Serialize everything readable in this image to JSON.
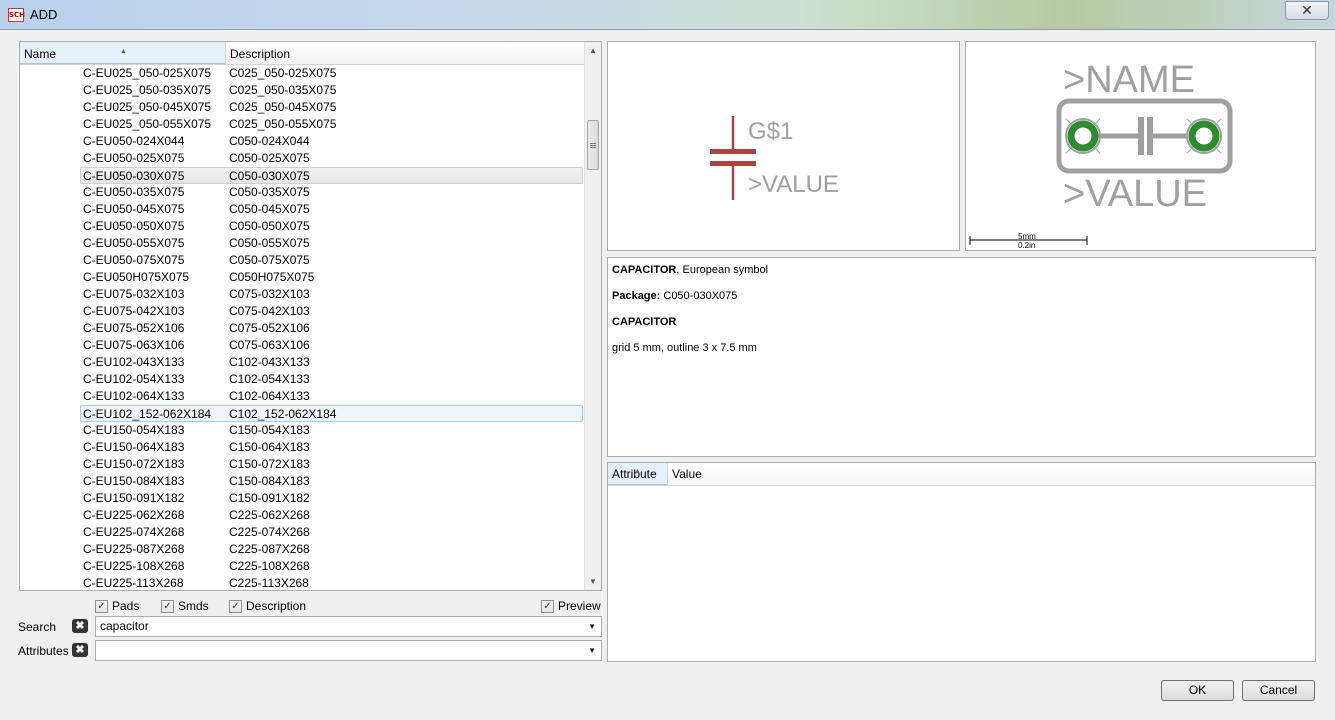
{
  "window": {
    "title": "ADD",
    "app_icon_text": "SCH",
    "close_glyph": "✕"
  },
  "list": {
    "columns": {
      "name": "Name",
      "description": "Description"
    },
    "rows": [
      {
        "name": "C-EU025_050-025X075",
        "desc": "C025_050-025X075",
        "state": ""
      },
      {
        "name": "C-EU025_050-035X075",
        "desc": "C025_050-035X075",
        "state": ""
      },
      {
        "name": "C-EU025_050-045X075",
        "desc": "C025_050-045X075",
        "state": ""
      },
      {
        "name": "C-EU025_050-055X075",
        "desc": "C025_050-055X075",
        "state": ""
      },
      {
        "name": "C-EU050-024X044",
        "desc": "C050-024X044",
        "state": ""
      },
      {
        "name": "C-EU050-025X075",
        "desc": "C050-025X075",
        "state": ""
      },
      {
        "name": "C-EU050-030X075",
        "desc": "C050-030X075",
        "state": "selected"
      },
      {
        "name": "C-EU050-035X075",
        "desc": "C050-035X075",
        "state": ""
      },
      {
        "name": "C-EU050-045X075",
        "desc": "C050-045X075",
        "state": ""
      },
      {
        "name": "C-EU050-050X075",
        "desc": "C050-050X075",
        "state": ""
      },
      {
        "name": "C-EU050-055X075",
        "desc": "C050-055X075",
        "state": ""
      },
      {
        "name": "C-EU050-075X075",
        "desc": "C050-075X075",
        "state": ""
      },
      {
        "name": "C-EU050H075X075",
        "desc": "C050H075X075",
        "state": ""
      },
      {
        "name": "C-EU075-032X103",
        "desc": "C075-032X103",
        "state": ""
      },
      {
        "name": "C-EU075-042X103",
        "desc": "C075-042X103",
        "state": ""
      },
      {
        "name": "C-EU075-052X106",
        "desc": "C075-052X106",
        "state": ""
      },
      {
        "name": "C-EU075-063X106",
        "desc": "C075-063X106",
        "state": ""
      },
      {
        "name": "C-EU102-043X133",
        "desc": "C102-043X133",
        "state": ""
      },
      {
        "name": "C-EU102-054X133",
        "desc": "C102-054X133",
        "state": ""
      },
      {
        "name": "C-EU102-064X133",
        "desc": "C102-064X133",
        "state": ""
      },
      {
        "name": "C-EU102_152-062X184",
        "desc": "C102_152-062X184",
        "state": "hover"
      },
      {
        "name": "C-EU150-054X183",
        "desc": "C150-054X183",
        "state": ""
      },
      {
        "name": "C-EU150-064X183",
        "desc": "C150-064X183",
        "state": ""
      },
      {
        "name": "C-EU150-072X183",
        "desc": "C150-072X183",
        "state": ""
      },
      {
        "name": "C-EU150-084X183",
        "desc": "C150-084X183",
        "state": ""
      },
      {
        "name": "C-EU150-091X182",
        "desc": "C150-091X182",
        "state": ""
      },
      {
        "name": "C-EU225-062X268",
        "desc": "C225-062X268",
        "state": ""
      },
      {
        "name": "C-EU225-074X268",
        "desc": "C225-074X268",
        "state": ""
      },
      {
        "name": "C-EU225-087X268",
        "desc": "C225-087X268",
        "state": ""
      },
      {
        "name": "C-EU225-108X268",
        "desc": "C225-108X268",
        "state": ""
      },
      {
        "name": "C-EU225-113X268",
        "desc": "C225-113X268",
        "state": ""
      }
    ]
  },
  "options": {
    "pads": {
      "label": "Pads",
      "checked": true
    },
    "smds": {
      "label": "Smds",
      "checked": true
    },
    "description": {
      "label": "Description",
      "checked": true
    },
    "preview": {
      "label": "Preview",
      "checked": true
    },
    "check_glyph": "✓"
  },
  "search": {
    "label": "Search",
    "value": "capacitor",
    "clear_glyph": "✖"
  },
  "attributes": {
    "label": "Attributes",
    "value": ""
  },
  "symbol_preview": {
    "name_text": "G$1",
    "value_text": ">VALUE",
    "symbol_color": "#a8453f",
    "text_color": "#a0a0a0"
  },
  "package_preview": {
    "name_text": ">NAME",
    "value_text": ">VALUE",
    "pad_color": "#2e8b2e",
    "outline_color": "#a0a0a0",
    "scale_mm": "5mm",
    "scale_in": "0.2in"
  },
  "description": {
    "line1_bold": "CAPACITOR",
    "line1_rest": ", European symbol",
    "package_label": "Package:",
    "package_value": "C050-030X075",
    "heading": "CAPACITOR",
    "detail": "grid 5 mm, outline 3 x 7.5 mm"
  },
  "attr_table": {
    "col_attribute": "Attribute",
    "col_value": "Value"
  },
  "buttons": {
    "ok": "OK",
    "cancel": "Cancel"
  }
}
